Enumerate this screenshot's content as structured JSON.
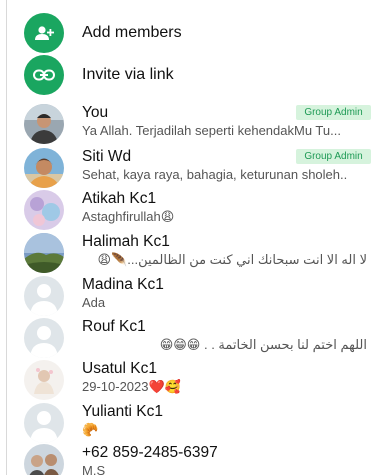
{
  "actions": [
    {
      "label": "Add members",
      "icon": "add-person-icon"
    },
    {
      "label": "Invite via link",
      "icon": "link-icon"
    }
  ],
  "colors": {
    "accent": "#1aa660",
    "badge_bg": "#d6f3dd",
    "badge_text": "#1e9a55"
  },
  "members": [
    {
      "name": "You",
      "status": "Ya Allah. Terjadilah seperti kehendakMu Tu...",
      "badge": "Group Admin",
      "avatar": "photo"
    },
    {
      "name": "Siti Wd",
      "status": "Sehat, kaya raya, bahagia, keturunan sholeh..",
      "badge": "Group Admin",
      "avatar": "photo"
    },
    {
      "name": "Atikah Kc1",
      "status": "Astaghfirullah😩",
      "badge": "",
      "avatar": "photo"
    },
    {
      "name": "Halimah Kc1",
      "status": "لا اله الا انت سبحانك اني كنت من الظالمين...🪶😩",
      "badge": "",
      "avatar": "photo"
    },
    {
      "name": "Madina Kc1",
      "status": "Ada",
      "badge": "",
      "avatar": "default"
    },
    {
      "name": "Rouf Kc1",
      "status": "اللهم اختم لنا بحسن الخاتمة . . 😁😁😁",
      "badge": "",
      "avatar": "default"
    },
    {
      "name": "Usatul Kc1",
      "status": "29-10-2023❤️🥰",
      "badge": "",
      "avatar": "photo"
    },
    {
      "name": "Yulianti Kc1",
      "status": "🥐",
      "badge": "",
      "avatar": "default"
    },
    {
      "name": "+62 859-2485-6397",
      "status": "M.S",
      "badge": "",
      "avatar": "photo"
    }
  ]
}
